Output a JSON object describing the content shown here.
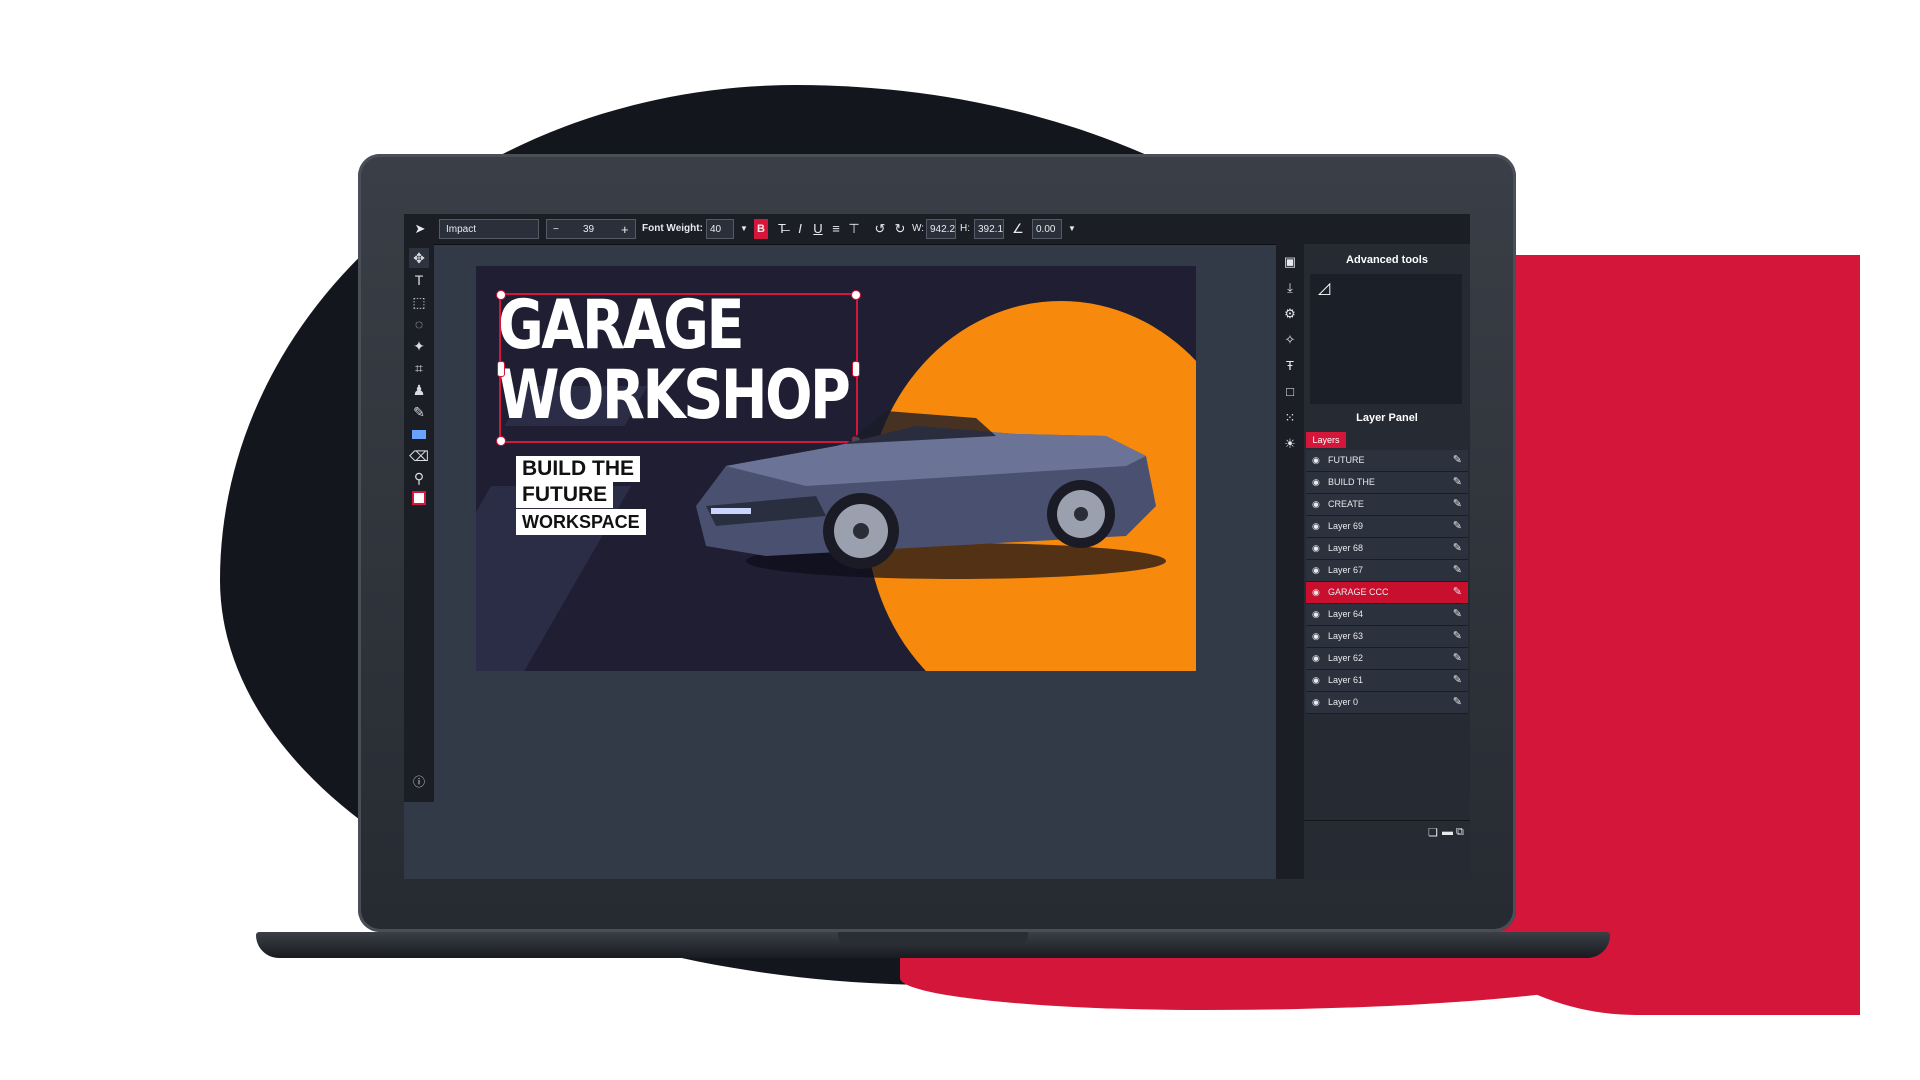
{
  "toolbar": {
    "font_name": "Impact",
    "font_size": "39",
    "minus": "−",
    "plus": "+",
    "font_weight_label": "Font Weight:",
    "font_weight_value": "40",
    "bold": "B",
    "width_label": "W:",
    "width_value": "942.20",
    "height_label": "H:",
    "height_value": "392.13",
    "rotation_value": "0.00"
  },
  "canvas": {
    "title_line1": "GARAGE",
    "title_line2": "WORKSHOP",
    "tag1": "BUILD THE",
    "tag2": "FUTURE",
    "tag3": "WORKSPACE",
    "accent_color": "#f7890c",
    "bg_color": "#1f1e33"
  },
  "panel": {
    "advanced_tools_title": "Advanced tools",
    "layer_panel_title": "Layer Panel",
    "layers_tab": "Layers",
    "layers": [
      {
        "name": "FUTURE",
        "selected": false
      },
      {
        "name": "BUILD THE",
        "selected": false
      },
      {
        "name": "CREATE",
        "selected": false
      },
      {
        "name": "Layer 69",
        "selected": false
      },
      {
        "name": "Layer 68",
        "selected": false
      },
      {
        "name": "Layer 67",
        "selected": false
      },
      {
        "name": "GARAGE CCC",
        "selected": true
      },
      {
        "name": "Layer 64",
        "selected": false
      },
      {
        "name": "Layer 63",
        "selected": false
      },
      {
        "name": "Layer 62",
        "selected": false
      },
      {
        "name": "Layer 61",
        "selected": false
      },
      {
        "name": "Layer 0",
        "selected": false
      }
    ]
  },
  "icons": {
    "left_tools": [
      "move-tool-icon",
      "text-tool-icon",
      "select-tool-icon",
      "lasso-tool-icon",
      "magic-wand-icon",
      "crop-tool-icon",
      "stamp-tool-icon",
      "brush-tool-icon",
      "shape-tool-icon",
      "eraser-tool-icon",
      "zoom-tool-icon",
      "color-picker-icon"
    ],
    "right_tools": [
      "save-icon",
      "download-icon",
      "settings-icon",
      "effects-icon",
      "text-style-icon",
      "frame-icon",
      "pattern-icon",
      "brightness-icon"
    ]
  },
  "brand_colors": {
    "red": "#d4163a",
    "dark": "#14161d"
  }
}
